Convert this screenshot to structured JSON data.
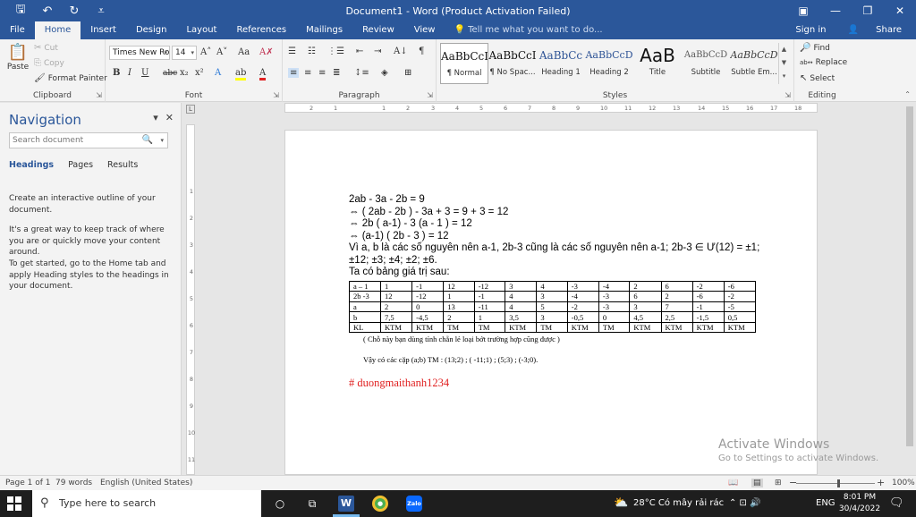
{
  "titlebar": {
    "title": "Document1  -  Word (Product Activation Failed)",
    "qat": [
      {
        "name": "save-icon",
        "glyph": "🖫"
      },
      {
        "name": "undo-icon",
        "glyph": "↶"
      },
      {
        "name": "redo-icon",
        "glyph": "↻"
      },
      {
        "name": "customize-qat-icon",
        "glyph": "⩡"
      }
    ],
    "window_buttons": [
      {
        "name": "ribbon-display-icon",
        "glyph": "▣"
      },
      {
        "name": "minimize-icon",
        "glyph": "—"
      },
      {
        "name": "restore-icon",
        "glyph": "❐"
      },
      {
        "name": "close-icon",
        "glyph": "✕"
      }
    ]
  },
  "tabs": [
    "File",
    "Home",
    "Insert",
    "Design",
    "Layout",
    "References",
    "Mailings",
    "Review",
    "View"
  ],
  "active_tab": "Home",
  "tell_me": "Tell me what you want to do...",
  "tell_me_icon": "💡",
  "sign_in": "Sign in",
  "share": "Share",
  "share_icon": "👤",
  "ribbon": {
    "clipboard": {
      "label": "Clipboard",
      "paste": "Paste",
      "paste_icon": "📋",
      "cut": "Cut",
      "copy": "Copy",
      "format_painter": "Format Painter",
      "cut_icon": "✂",
      "copy_icon": "⎘",
      "painter_icon": "🖌"
    },
    "font": {
      "label": "Font",
      "font_name": "Times New Ro",
      "font_size": "14",
      "grow": "A˄",
      "shrink": "A˅",
      "case": "Aa",
      "clear": "A✗",
      "bold": "B",
      "italic": "I",
      "underline": "U",
      "strike": "abc",
      "subscript": "x₂",
      "superscript": "x²",
      "effects": "A",
      "highlight": "ab",
      "font_color": "A"
    },
    "paragraph": {
      "label": "Paragraph",
      "bullets": "☰",
      "numbering": "☷",
      "multilevel": "⋮☰",
      "decrease_indent": "⇤",
      "increase_indent": "⇥",
      "sort": "A↓",
      "show_marks": "¶",
      "align_left": "≡",
      "center": "≡",
      "align_right": "≡",
      "justify": "≣",
      "line_spacing": "↕≡",
      "shading": "◈",
      "borders": "⊞"
    },
    "styles": {
      "label": "Styles",
      "items": [
        {
          "sample": "AaBbCcI",
          "name": "¶ Normal"
        },
        {
          "sample": "AaBbCcI",
          "name": "¶ No Spac..."
        },
        {
          "sample": "AaBbCc",
          "name": "Heading 1"
        },
        {
          "sample": "AaBbCcD",
          "name": "Heading 2"
        },
        {
          "sample": "AaB",
          "name": "Title"
        },
        {
          "sample": "AaBbCcD",
          "name": "Subtitle"
        },
        {
          "sample": "AaBbCcD",
          "name": "Subtle Em..."
        }
      ]
    },
    "editing": {
      "label": "Editing",
      "find": "Find",
      "replace": "Replace",
      "select": "Select",
      "find_icon": "🔎",
      "replace_icon": "ab↔",
      "select_icon": "↖"
    }
  },
  "navigation": {
    "title": "Navigation",
    "search_placeholder": "Search document",
    "tabs": [
      "Headings",
      "Pages",
      "Results"
    ],
    "active_tab": "Headings",
    "paragraphs": [
      "Create an interactive outline of your document.",
      "It's a great way to keep track of where you are or quickly move your content around.",
      "To get started, go to the Home tab and apply Heading styles to the headings in your document."
    ]
  },
  "ruler": {
    "h_ticks": [
      "2",
      "1",
      "",
      "1",
      "2",
      "3",
      "4",
      "5",
      "6",
      "7",
      "8",
      "9",
      "10",
      "11",
      "12",
      "13",
      "14",
      "15",
      "16",
      "17",
      "18"
    ],
    "v_ticks": [
      "1",
      "2",
      "3",
      "4",
      "5",
      "6",
      "7",
      "8",
      "9",
      "10",
      "11"
    ]
  },
  "document": {
    "lines": [
      "2ab - 3a - 2b = 9",
      "⇔  ( 2ab - 2b ) - 3a + 3 = 9 + 3 = 12",
      "⇔  2b ( a-1)  - 3 (a - 1 ) = 12",
      "⇔ (a-1) ( 2b - 3 ) = 12",
      "Vì a, b là các số nguyên nên a-1, 2b-3 cũng là các số nguyên nên a-1; 2b-3 ∈ Ư(12) = ±1;",
      "±12; ±3; ±4; ±2; ±6.",
      "Ta có bảng giá trị sau:"
    ],
    "table": [
      [
        "a – 1",
        "1",
        "-1",
        "12",
        "-12",
        "3",
        "4",
        "-3",
        "-4",
        "2",
        "6",
        "-2",
        "-6"
      ],
      [
        "2b -3",
        "12",
        "-12",
        "1",
        "-1",
        "4",
        "3",
        "-4",
        "-3",
        "6",
        "2",
        "-6",
        "-2"
      ],
      [
        "a",
        "2",
        "0",
        "13",
        "-11",
        "4",
        "5",
        "-2",
        "-3",
        "3",
        "7",
        "-1",
        "-5"
      ],
      [
        "b",
        "7,5",
        "-4,5",
        "2",
        "1",
        "3,5",
        "3",
        "-0,5",
        "0",
        "4,5",
        "2,5",
        "-1,5",
        "0,5"
      ],
      [
        "KL",
        "KTM",
        "KTM",
        "TM",
        "TM",
        "KTM",
        "TM",
        "KTM",
        "TM",
        "KTM",
        "KTM",
        "KTM",
        "KTM"
      ]
    ],
    "note": "( Chỗ này bạn dùng tính chẵn lẻ loại bớt trường hợp cũng được )",
    "answer": "Vậy có các cặp (a;b) TM : (13;2) ;  ( -11;1) ; (5;3) ; (-3;0).",
    "signature": "# duongmaithanh1234"
  },
  "watermark": {
    "line1": "Activate Windows",
    "line2": "Go to Settings to activate Windows."
  },
  "status": {
    "page": "Page 1 of 1",
    "words": "79 words",
    "language": "English (United States)",
    "zoom": "100%",
    "zoom_minus": "−",
    "zoom_plus": "+",
    "view_read": "📖",
    "view_print": "▤",
    "view_web": "⊞"
  },
  "taskbar": {
    "search_placeholder": "Type here to search",
    "search_icon": "⚲",
    "task_view_icon": "⧉",
    "cortana_icon": "○",
    "word_label": "W",
    "chrome_label": "●",
    "zalo_label": "Zalo",
    "weather_icon": "⛅",
    "weather": "28°C  Có mây rải rác",
    "tray_icons": "⌃  ⊡  🔊",
    "language": "ENG",
    "time": "8:01 PM",
    "date": "30/4/2022",
    "notifications_icon": "🗨"
  }
}
